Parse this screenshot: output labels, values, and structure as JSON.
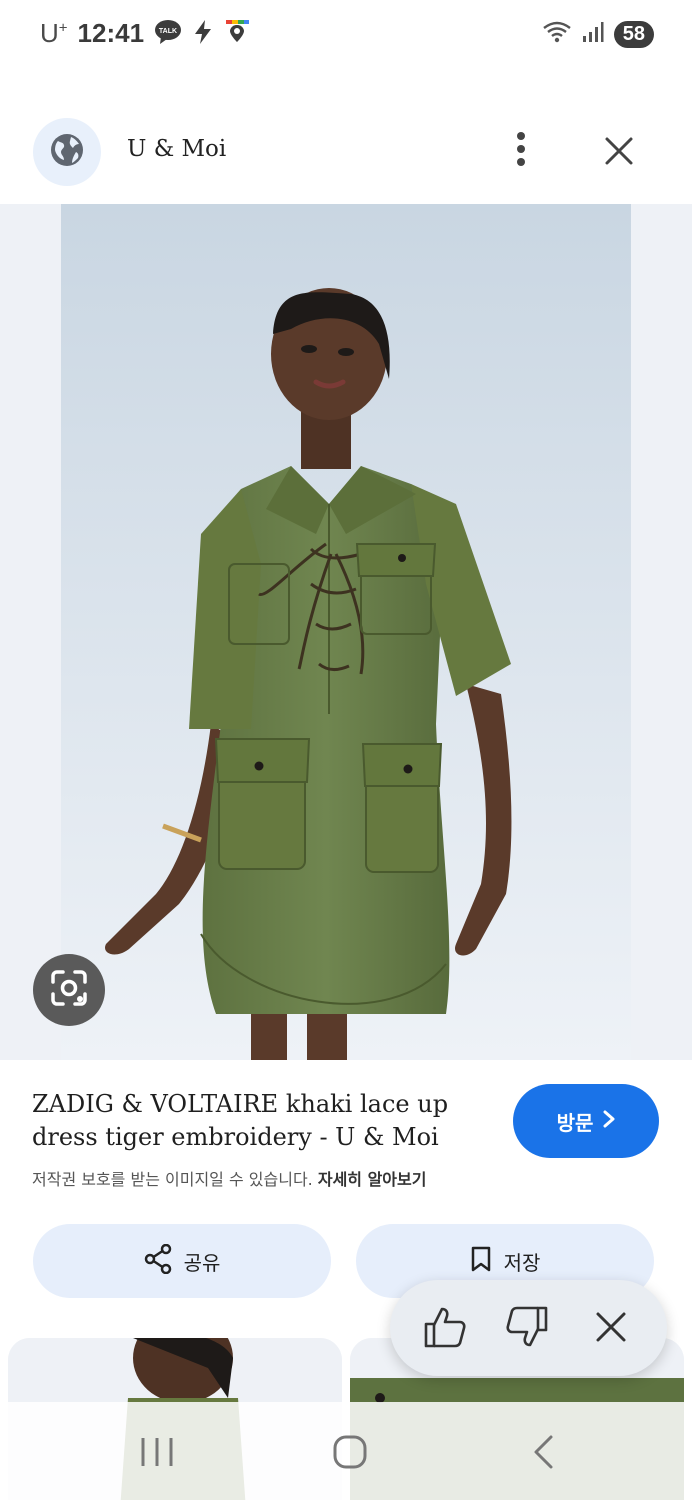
{
  "status_bar": {
    "carrier": "U",
    "carrier_plus": "+",
    "time": "12:41",
    "talk_badge": "TALK",
    "battery": "58",
    "icons": [
      "talk-icon",
      "charging-icon",
      "location-icon",
      "wifi-icon",
      "signal-icon"
    ]
  },
  "top_bar": {
    "site_name": "U & Moi",
    "icons": [
      "globe-icon",
      "more-vert-icon",
      "close-icon"
    ]
  },
  "result": {
    "title": "ZADIG & VOLTAIRE khaki lace up dress tiger embroidery - U & Moi",
    "copyright_notice": "저작권 보호를 받는 이미지일 수 있습니다.",
    "learn_more": "자세히 알아보기",
    "visit_label": "방문"
  },
  "actions": {
    "share_label": "공유",
    "save_label": "저장"
  },
  "feedback": {
    "icons": [
      "thumb-up-icon",
      "thumb-down-icon",
      "close-icon"
    ]
  },
  "colors": {
    "accent": "#1a73e8",
    "dress": "#6b7f4a",
    "button_bg": "#e6eefb"
  }
}
